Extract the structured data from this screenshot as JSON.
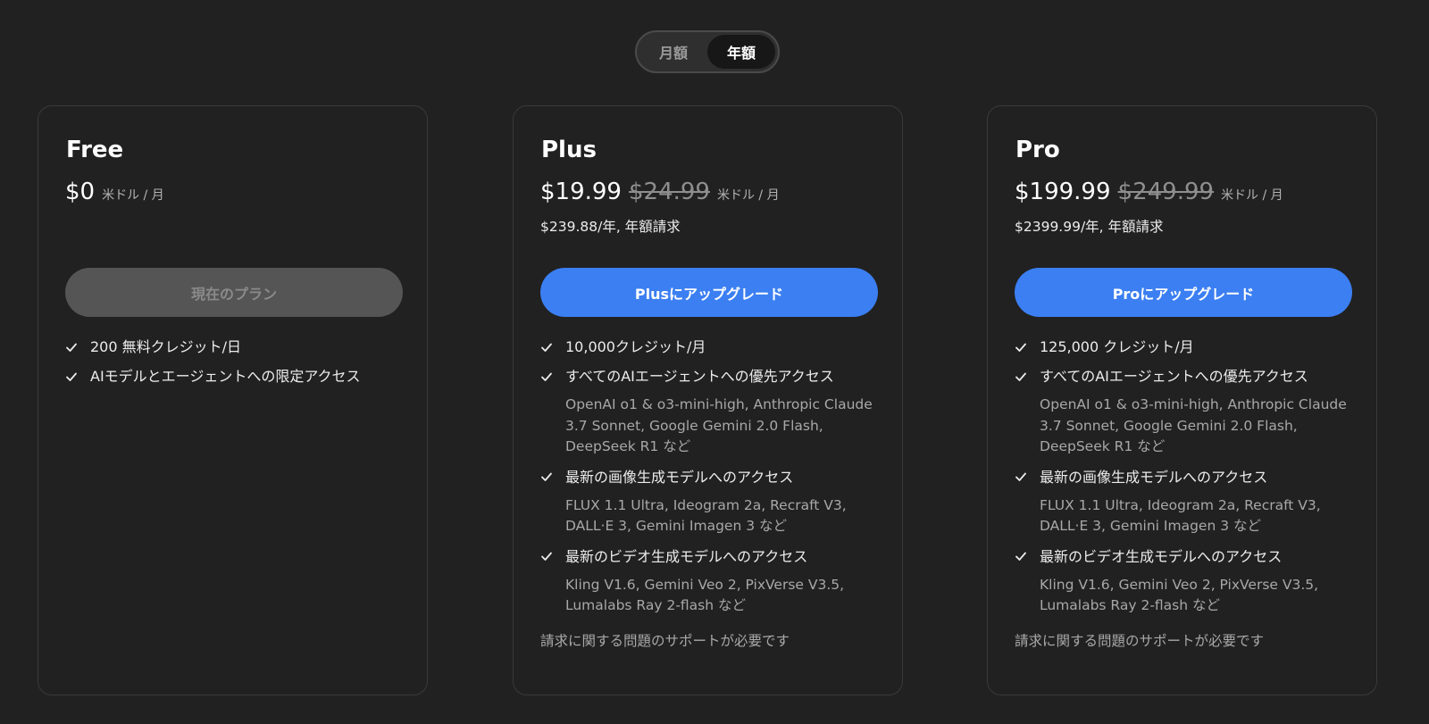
{
  "billing_toggle": {
    "monthly": "月額",
    "yearly": "年額",
    "selected": "yearly"
  },
  "plans": [
    {
      "name": "Free",
      "price": "$0",
      "price_old": "",
      "price_unit": "米ドル / 月",
      "billing": "",
      "cta": "現在のプラン",
      "cta_style": "disabled",
      "features": [
        {
          "text": "200 無料クレジット/日",
          "detail": ""
        },
        {
          "text": "AIモデルとエージェントへの限定アクセス",
          "detail": ""
        }
      ],
      "support": ""
    },
    {
      "name": "Plus",
      "price": "$19.99",
      "price_old": "$24.99",
      "price_unit": "米ドル / 月",
      "billing": "$239.88/年, 年額請求",
      "cta": "Plusにアップグレード",
      "cta_style": "primary",
      "features": [
        {
          "text": "10,000クレジット/月",
          "detail": ""
        },
        {
          "text": "すべてのAIエージェントへの優先アクセス",
          "detail": "OpenAI o1 & o3-mini-high, Anthropic Claude 3.7 Sonnet, Google Gemini 2.0 Flash, DeepSeek R1 など"
        },
        {
          "text": "最新の画像生成モデルへのアクセス",
          "detail": "FLUX 1.1 Ultra, Ideogram 2a, Recraft V3, DALL·E 3, Gemini Imagen 3 など"
        },
        {
          "text": "最新のビデオ生成モデルへのアクセス",
          "detail": "Kling V1.6, Gemini Veo 2, PixVerse V3.5, Lumalabs Ray 2-flash など"
        }
      ],
      "support": "請求に関する問題のサポートが必要です"
    },
    {
      "name": "Pro",
      "price": "$199.99",
      "price_old": "$249.99",
      "price_unit": "米ドル / 月",
      "billing": "$2399.99/年, 年額請求",
      "cta": "Proにアップグレード",
      "cta_style": "primary",
      "features": [
        {
          "text": "125,000 クレジット/月",
          "detail": ""
        },
        {
          "text": "すべてのAIエージェントへの優先アクセス",
          "detail": "OpenAI o1 & o3-mini-high, Anthropic Claude 3.7 Sonnet, Google Gemini 2.0 Flash, DeepSeek R1 など"
        },
        {
          "text": "最新の画像生成モデルへのアクセス",
          "detail": "FLUX 1.1 Ultra, Ideogram 2a, Recraft V3, DALL·E 3, Gemini Imagen 3 など"
        },
        {
          "text": "最新のビデオ生成モデルへのアクセス",
          "detail": "Kling V1.6, Gemini Veo 2, PixVerse V3.5, Lumalabs Ray 2-flash など"
        }
      ],
      "support": "請求に関する問題のサポートが必要です"
    }
  ],
  "colors": {
    "background": "#212121",
    "accent": "#3b7ff2",
    "disabled": "#555555"
  }
}
